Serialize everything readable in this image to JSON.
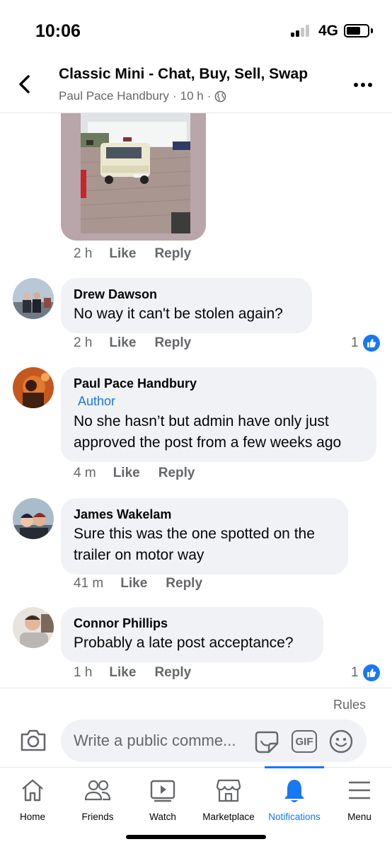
{
  "status_bar": {
    "time": "10:06",
    "network": "4G",
    "battery_level": 0.6
  },
  "header": {
    "title": "Classic Mini - Chat, Buy, Sell, Swap",
    "author": "Paul Pace Handbury",
    "time": "10 h",
    "separator": "·"
  },
  "photo_comment": {
    "time": "2 h",
    "like_label": "Like",
    "reply_label": "Reply"
  },
  "comments": [
    {
      "name": "Drew Dawson",
      "badge": "",
      "text": "No way it can't be stolen again?",
      "time": "2 h",
      "like_label": "Like",
      "reply_label": "Reply",
      "reactions": "1"
    },
    {
      "name": "Paul Pace Handbury",
      "badge": "Author",
      "text": "No she hasn’t but admin have only just approved the post from a few weeks ago",
      "time": "4 m",
      "like_label": "Like",
      "reply_label": "Reply",
      "reactions": ""
    },
    {
      "name": "James Wakelam",
      "badge": "",
      "text": "Sure this was the one spotted on the trailer on motor way",
      "time": "41 m",
      "like_label": "Like",
      "reply_label": "Reply",
      "reactions": ""
    },
    {
      "name": "Connor Phillips",
      "badge": "",
      "text": "Probably a late post acceptance?",
      "time": "1 h",
      "like_label": "Like",
      "reply_label": "Reply",
      "reactions": "1"
    }
  ],
  "composer": {
    "rules_label": "Rules",
    "placeholder": "Write a public comme...",
    "gif_label": "GIF"
  },
  "tabs": [
    {
      "label": "Home",
      "icon": "home-icon"
    },
    {
      "label": "Friends",
      "icon": "friends-icon"
    },
    {
      "label": "Watch",
      "icon": "watch-icon"
    },
    {
      "label": "Marketplace",
      "icon": "marketplace-icon"
    },
    {
      "label": "Notifications",
      "icon": "bell-icon",
      "active": true
    },
    {
      "label": "Menu",
      "icon": "menu-icon"
    }
  ],
  "colors": {
    "accent": "#1877f2",
    "bubble": "#f0f2f5",
    "muted": "#65676b"
  }
}
